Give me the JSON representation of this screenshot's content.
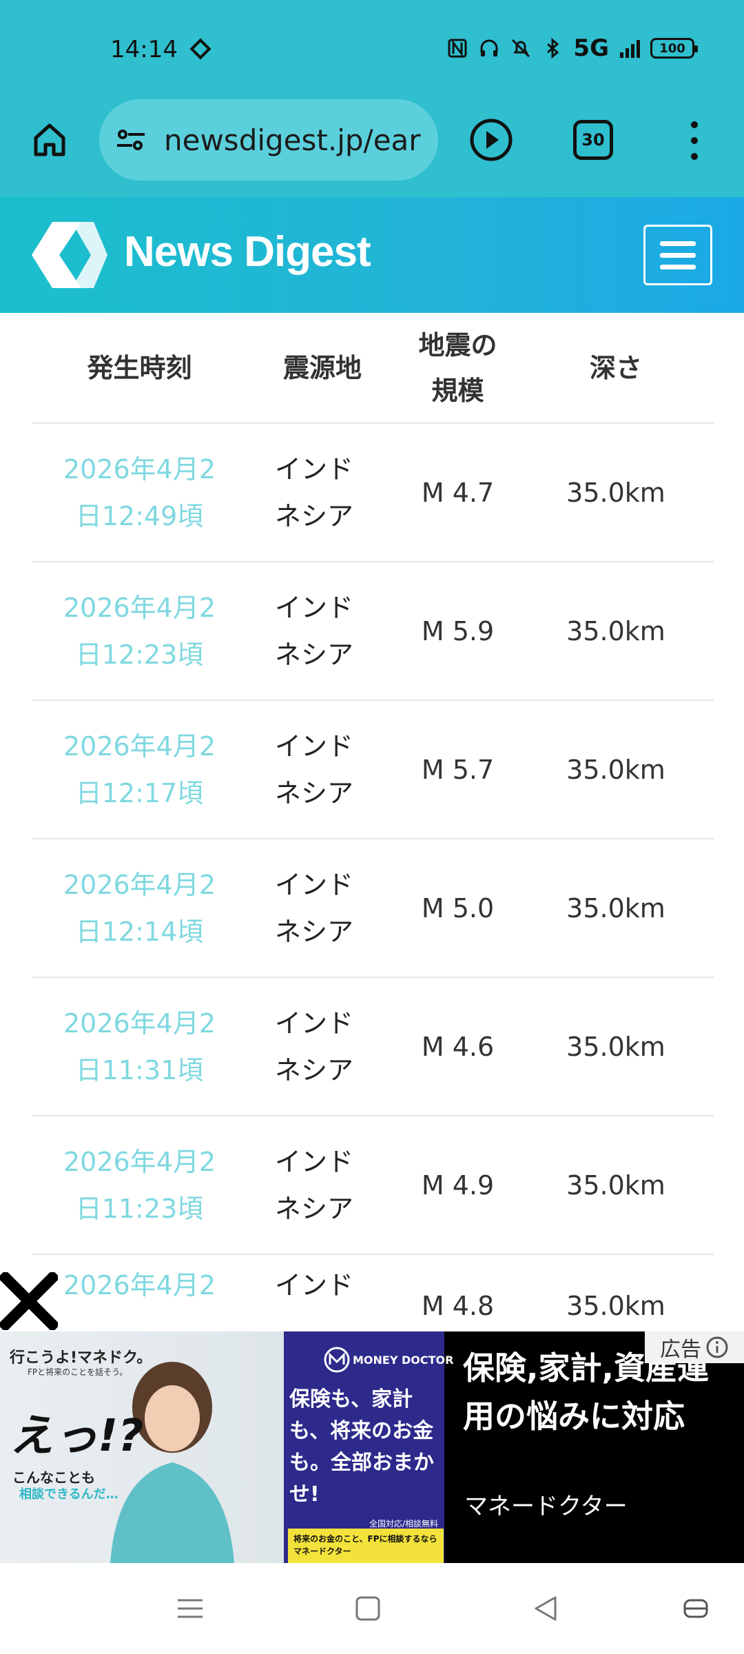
{
  "status_bar": {
    "time": "14:14",
    "network": "5G",
    "battery": "100"
  },
  "browser": {
    "url": "newsdigest.jp/ear",
    "tab_count": "30"
  },
  "site": {
    "logo_text": "News Digest",
    "brand_colors": [
      "#1bbfcc",
      "#1aa9e6"
    ]
  },
  "table": {
    "headers": {
      "time": "発生時刻",
      "place": "震源地",
      "magnitude": "地震の規模",
      "depth": "深さ"
    },
    "rows": [
      {
        "time": "2026年4月2日12:49頃",
        "place": "インドネシア",
        "magnitude": "M 4.7",
        "depth": "35.0km"
      },
      {
        "time": "2026年4月2日12:23頃",
        "place": "インドネシア",
        "magnitude": "M 5.9",
        "depth": "35.0km"
      },
      {
        "time": "2026年4月2日12:17頃",
        "place": "インドネシア",
        "magnitude": "M 5.7",
        "depth": "35.0km"
      },
      {
        "time": "2026年4月2日12:14頃",
        "place": "インドネシア",
        "magnitude": "M 5.0",
        "depth": "35.0km"
      },
      {
        "time": "2026年4月2日11:31頃",
        "place": "インドネシア",
        "magnitude": "M 4.6",
        "depth": "35.0km"
      },
      {
        "time": "2026年4月2日11:23頃",
        "place": "インドネシア",
        "magnitude": "M 4.9",
        "depth": "35.0km"
      },
      {
        "time": "2026年4月2",
        "place": "インド",
        "magnitude": "M 4.8",
        "depth": "35.0km"
      }
    ]
  },
  "ad": {
    "label": "広告",
    "brand_line": "行こうよ!マネドク。",
    "sub_line": "FPと将来のことを話そう。",
    "exclaim": "えっ!?",
    "small1": "こんなことも",
    "small2": "相談できるんだ…",
    "md_name": "MONEY DOCTOR",
    "blue_copy": "保険も、家計も、将来のお金も。全部おまかせ!",
    "tag": "全国対応/相談無料",
    "yellow_copy": "将来のお金のこと、FPに相談するならマネードクター",
    "title": "保険,家計,資産運用の悩みに対応",
    "advertiser": "マネードクター"
  }
}
